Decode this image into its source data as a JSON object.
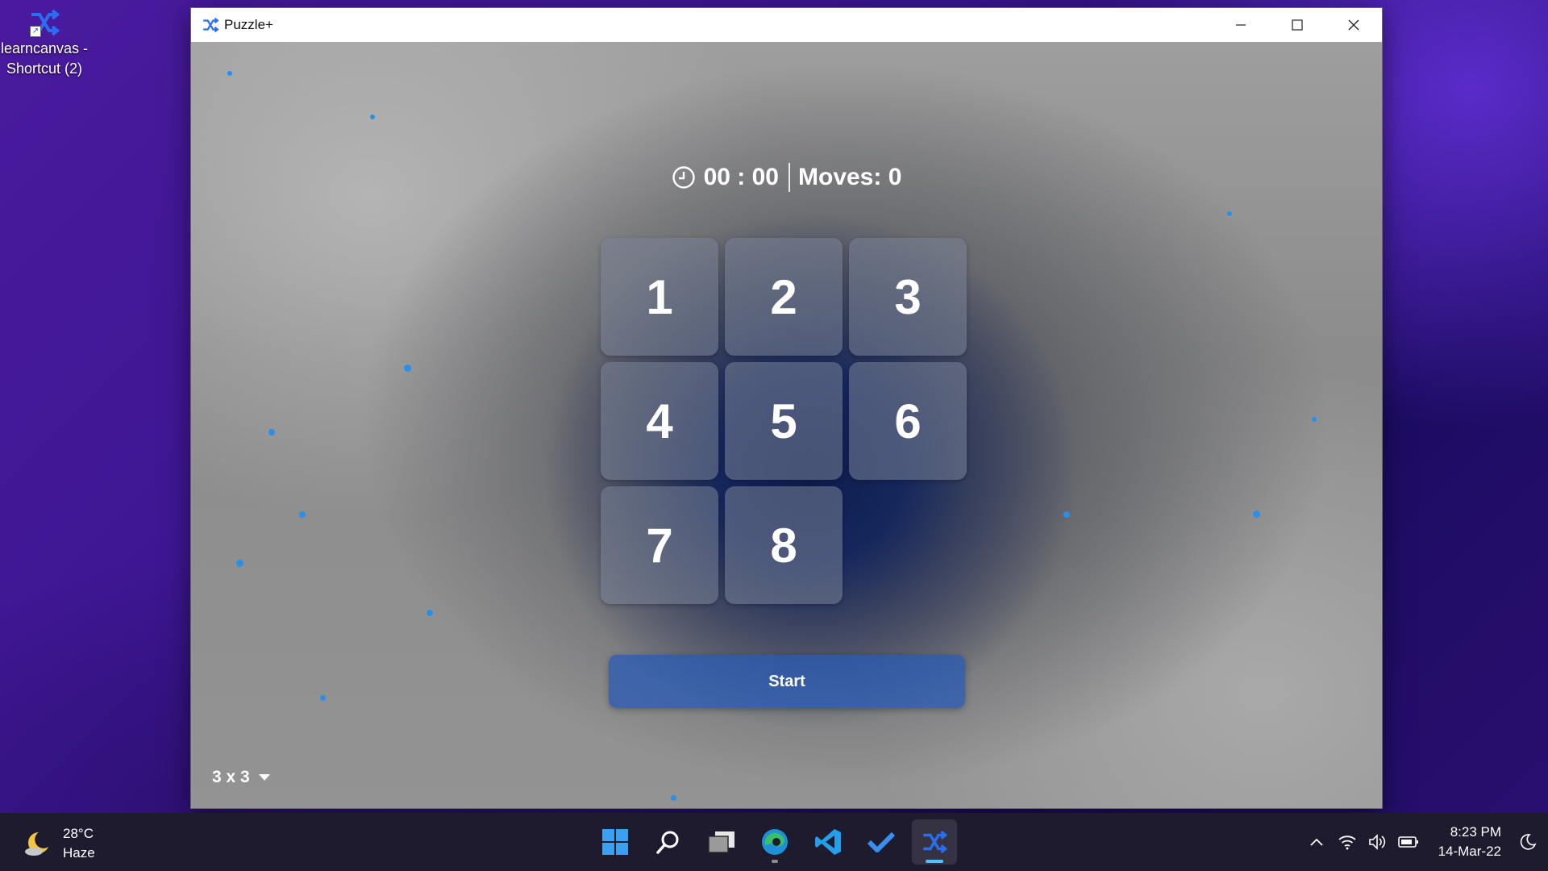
{
  "desktop": {
    "shortcut_label_line1": "learncanvas -",
    "shortcut_label_line2": "Shortcut (2)"
  },
  "window": {
    "title": "Puzzle+"
  },
  "game": {
    "timer": "00 : 00",
    "moves": "Moves: 0",
    "tiles": [
      "1",
      "2",
      "3",
      "4",
      "5",
      "6",
      "7",
      "8"
    ],
    "start_label": "Start",
    "grid_size": "3 x 3"
  },
  "taskbar": {
    "weather_temp": "28°C",
    "weather_desc": "Haze",
    "time": "8:23 PM",
    "date": "14-Mar-22"
  },
  "colors": {
    "accent": "#4cc2ff",
    "start_button": "#285ab4",
    "taskbar_bg": "#1f1b2e"
  }
}
